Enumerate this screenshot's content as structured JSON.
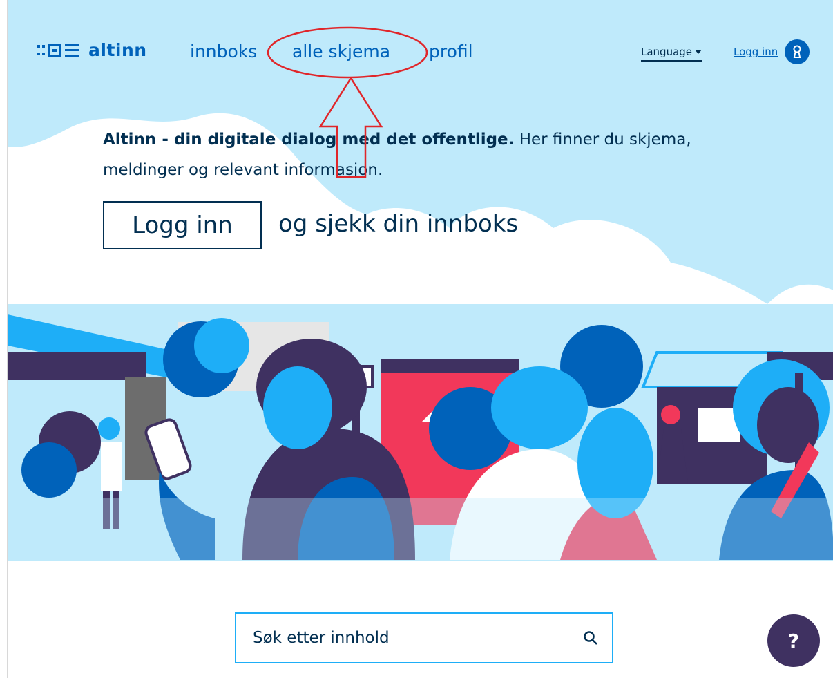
{
  "header": {
    "brand": "altinn",
    "nav": [
      {
        "label": "innboks"
      },
      {
        "label": "alle skjema"
      },
      {
        "label": "profil"
      }
    ],
    "language_label": "Language",
    "login_label": "Logg inn"
  },
  "hero": {
    "intro_bold": "Altinn - din digitale dialog med det offentlige.",
    "intro_rest": " Her finner du skjema, meldinger og relevant informasjon.",
    "login_button": "Logg inn",
    "login_tail": "og sjekk din innboks"
  },
  "search": {
    "placeholder": "Søk etter innhold"
  },
  "help": {
    "label": "?"
  },
  "colors": {
    "sky": "#bfeafb",
    "brand_blue": "#0062ba",
    "navy": "#022f51",
    "purple": "#3f3161",
    "red": "#f2385a",
    "cyan": "#1eaef7",
    "annotation": "#e0262a"
  },
  "icons": [
    "altinn-logo-icon",
    "chevron-down-icon",
    "keyhole-icon",
    "search-icon",
    "red-arrow-annotation"
  ]
}
